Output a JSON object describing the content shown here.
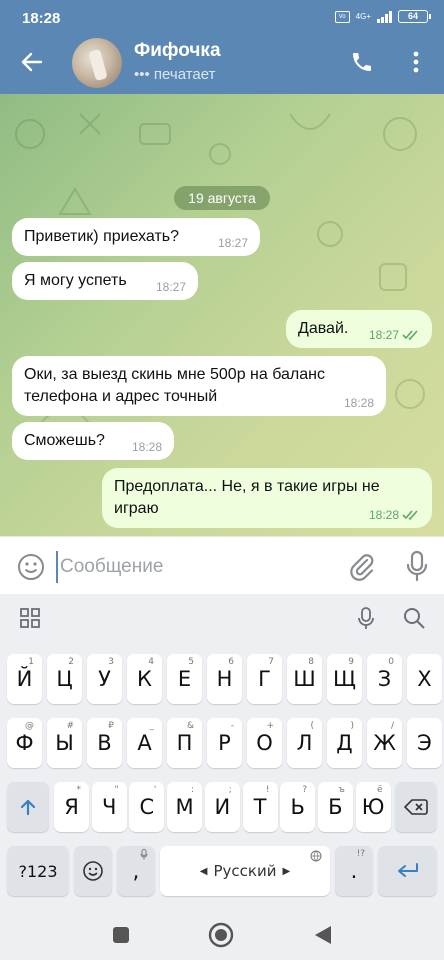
{
  "status": {
    "time": "18:28",
    "network": "4G+",
    "battery": "64",
    "volte": "VoLTE"
  },
  "header": {
    "title": "Фифочка",
    "subtitle": "••• печатает"
  },
  "chat": {
    "date": "19 августа",
    "messages": [
      {
        "direction": "in",
        "text": "Приветик) приехать?",
        "time": "18:27"
      },
      {
        "direction": "in",
        "text": "Я могу успеть",
        "time": "18:27"
      },
      {
        "direction": "out",
        "text": "Давай.",
        "time": "18:27",
        "read": true
      },
      {
        "direction": "in",
        "text": "Оки, за выезд скинь мне 500р на баланс телефона и адрес точный",
        "time": "18:28"
      },
      {
        "direction": "in",
        "text": "Сможешь?",
        "time": "18:28"
      },
      {
        "direction": "out",
        "text": "Предоплата... Не, я в такие игры не играю",
        "time": "18:28",
        "read": true
      }
    ]
  },
  "composer": {
    "placeholder": "Сообщение"
  },
  "keyboard": {
    "row1": [
      [
        "Й",
        "1"
      ],
      [
        "Ц",
        "2"
      ],
      [
        "У",
        "3"
      ],
      [
        "К",
        "4"
      ],
      [
        "Е",
        "5"
      ],
      [
        "Н",
        "6"
      ],
      [
        "Г",
        "7"
      ],
      [
        "Ш",
        "8"
      ],
      [
        "Щ",
        "9"
      ],
      [
        "З",
        "0"
      ],
      [
        "Х",
        ""
      ]
    ],
    "row2": [
      [
        "Ф",
        "@"
      ],
      [
        "Ы",
        "#"
      ],
      [
        "В",
        "₽"
      ],
      [
        "А",
        "_"
      ],
      [
        "П",
        "&"
      ],
      [
        "Р",
        "-"
      ],
      [
        "О",
        "+"
      ],
      [
        "Л",
        "("
      ],
      [
        "Д",
        ")"
      ],
      [
        "Ж",
        "/"
      ],
      [
        "Э",
        ""
      ]
    ],
    "row3": [
      [
        "Я",
        "*"
      ],
      [
        "Ч",
        "\""
      ],
      [
        "С",
        "'"
      ],
      [
        "М",
        ":"
      ],
      [
        "И",
        ";"
      ],
      [
        "Т",
        "!"
      ],
      [
        "Ь",
        "?"
      ],
      [
        "Б",
        "ъ"
      ],
      [
        "Ю",
        "ё"
      ]
    ],
    "symbols_key": "?123",
    "comma_key": ",",
    "space_label": "Русский",
    "period_key": ".",
    "period_hint": "!?"
  },
  "colors": {
    "header": "#5b87b4",
    "outgoing_bubble": "#effedd",
    "incoming_bubble": "#ffffff",
    "accent": "#5b87b4"
  }
}
